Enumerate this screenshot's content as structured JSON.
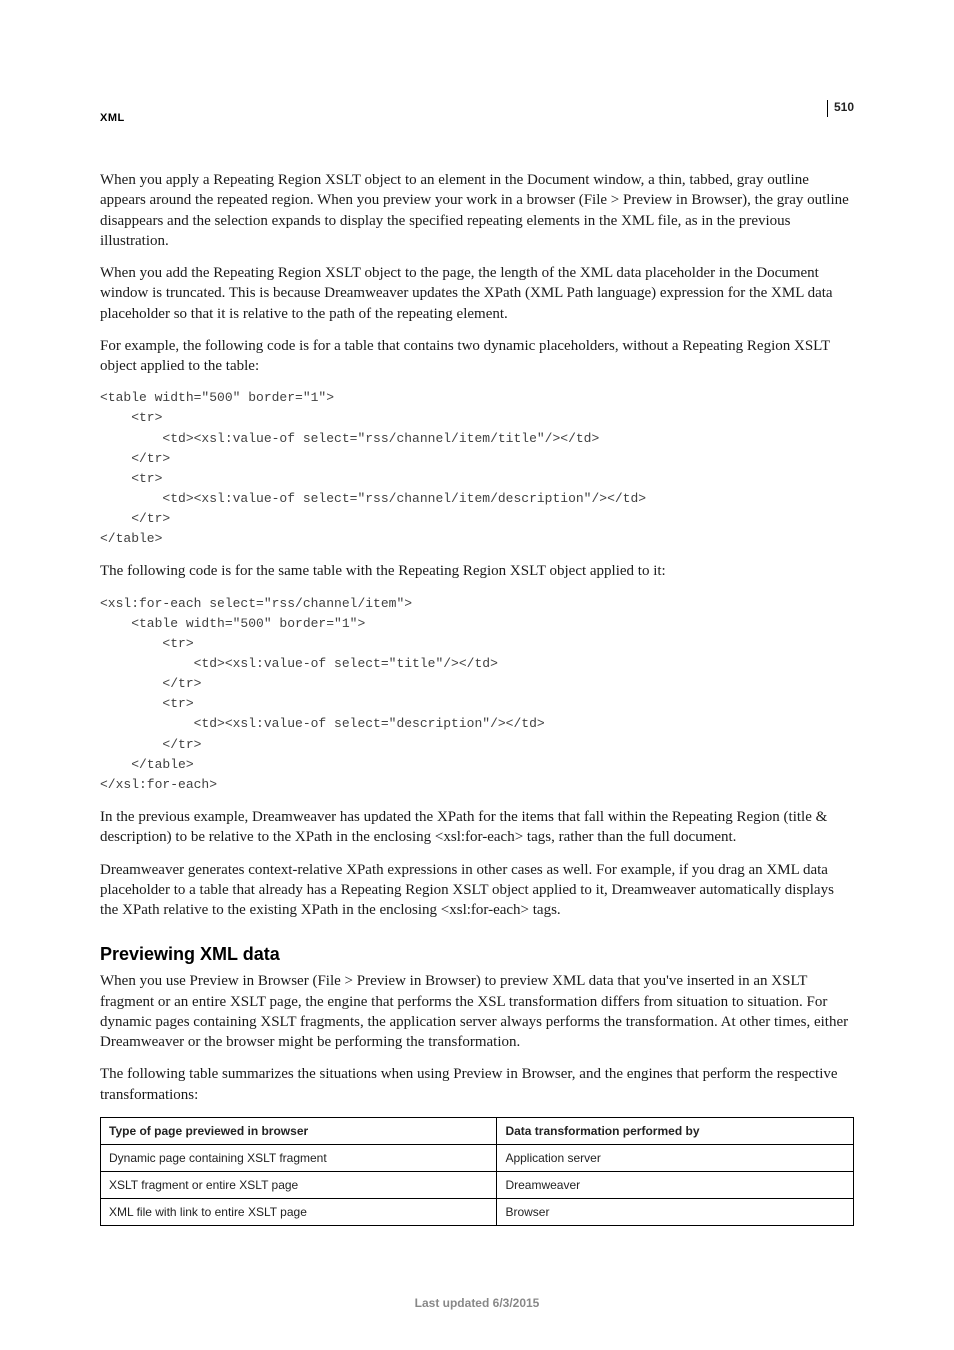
{
  "header": {
    "section_label": "XML",
    "page_number": "510"
  },
  "paragraphs": {
    "p1": "When you apply a Repeating Region XSLT object to an element in the Document window, a thin, tabbed, gray outline appears around the repeated region. When you preview your work in a browser (File > Preview in Browser), the gray outline disappears and the selection expands to display the specified repeating elements in the XML file, as in the previous illustration.",
    "p2": "When you add the Repeating Region XSLT object to the page, the length of the XML data placeholder in the Document window is truncated. This is because Dreamweaver updates the XPath (XML Path language) expression for the XML data placeholder so that it is relative to the path of the repeating element.",
    "p3": "For example, the following code is for a table that contains two dynamic placeholders, without a Repeating Region XSLT object applied to the table:",
    "p4": "The following code is for the same table with the Repeating Region XSLT object applied to it:",
    "p5": "In the previous example, Dreamweaver has updated the XPath for the items that fall within the Repeating Region (title & description) to be relative to the XPath in the enclosing <xsl:for-each> tags, rather than the full document.",
    "p6": "Dreamweaver generates context-relative XPath expressions in other cases as well. For example, if you drag an XML data placeholder to a table that already has a Repeating Region XSLT object applied to it, Dreamweaver automatically displays the XPath relative to the existing XPath in the enclosing <xsl:for-each> tags.",
    "p7": "When you use Preview in Browser (File > Preview in Browser) to preview XML data that you've inserted in an XSLT fragment or an entire XSLT page, the engine that performs the XSL transformation differs from situation to situation. For dynamic pages containing XSLT fragments, the application server always performs the transformation. At other times, either Dreamweaver or the browser might be performing the transformation.",
    "p8": "The following table summarizes the situations when using Preview in Browser, and the engines that perform the respective transformations:"
  },
  "code_blocks": {
    "code1": "<table width=\"500\" border=\"1\"> \n    <tr> \n        <td><xsl:value-of select=\"rss/channel/item/title\"/></td> \n    </tr> \n    <tr> \n        <td><xsl:value-of select=\"rss/channel/item/description\"/></td> \n    </tr> \n</table>",
    "code2": "<xsl:for-each select=\"rss/channel/item\"> \n    <table width=\"500\" border=\"1\"> \n        <tr> \n            <td><xsl:value-of select=\"title\"/></td> \n        </tr> \n        <tr> \n            <td><xsl:value-of select=\"description\"/></td> \n        </tr> \n    </table> \n</xsl:for-each>"
  },
  "section_heading": "Previewing XML data",
  "table": {
    "headers": {
      "col1": "Type of page previewed in browser",
      "col2": "Data transformation performed by"
    },
    "rows": [
      {
        "col1": "Dynamic page containing XSLT fragment",
        "col2": "Application server"
      },
      {
        "col1": "XSLT fragment or entire XSLT page",
        "col2": "Dreamweaver"
      },
      {
        "col1": "XML file with link to entire XSLT page",
        "col2": "Browser"
      }
    ]
  },
  "footer": {
    "last_updated": "Last updated 6/3/2015"
  }
}
